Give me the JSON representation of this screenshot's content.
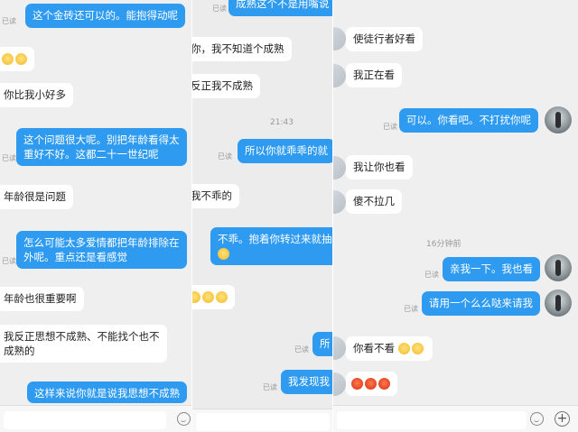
{
  "status": {
    "read": "已读"
  },
  "panel1": {
    "messages": [
      "这个金砖还可以的。能抱得动呢",
      "你比我小好多",
      "这个问题很大呢。别把年龄看得太",
      "重好不好。这都二十一世纪呢",
      "年龄很是问题",
      "怎么可能太多爱情都把年龄排除在",
      "外呢。重点还是看感觉",
      "年龄也很重要啊",
      "我反正思想不成熟、不能找个也不",
      "成熟的",
      "这样来说你就是说我思想不成熟"
    ]
  },
  "panel2": {
    "time": "21:43",
    "messages": [
      "成熟这个不是用嘴说",
      "你，我不知道个成熟",
      "反正我不成熟",
      "所以你就乖乖的就",
      "我不乖的",
      "不乖。抱着你转过来就抽",
      "所",
      "我发现我"
    ]
  },
  "panel3": {
    "time": "16分钟前",
    "messages": [
      "使徒行者好看",
      "我正在看",
      "可以。你看吧。不打扰你呢",
      "我让你也看",
      "傻不拉几",
      "亲我一下。我也看",
      "请用一个么么哒来请我",
      "你看不看"
    ],
    "icons": {
      "emoji": "smile-icon",
      "more": "plus-icon"
    }
  }
}
